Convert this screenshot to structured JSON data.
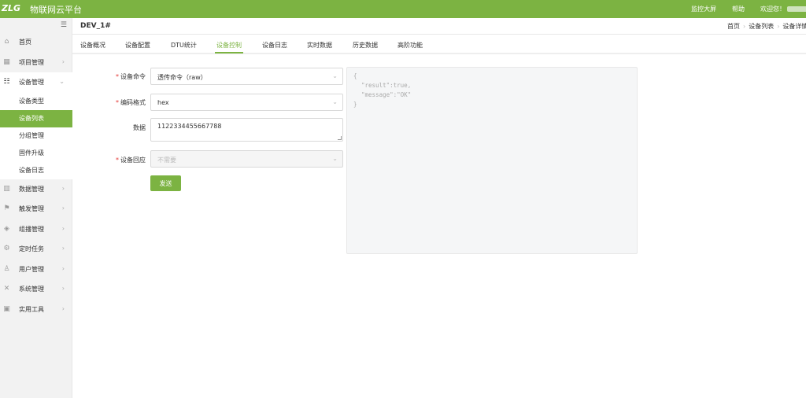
{
  "header": {
    "logo": "ZLG",
    "brand": "物联网云平台",
    "links": {
      "monitor": "监控大屏",
      "help": "帮助",
      "welcome": "欢迎您！"
    }
  },
  "sidebar": {
    "collapse_icon": "collapse-icon",
    "items": [
      {
        "label": "首页",
        "icon": "home-icon"
      },
      {
        "label": "项目管理",
        "icon": "project-icon"
      },
      {
        "label": "设备管理",
        "icon": "device-icon"
      },
      {
        "label": "数据管理",
        "icon": "chart-icon"
      },
      {
        "label": "触发管理",
        "icon": "flag-icon"
      },
      {
        "label": "组播管理",
        "icon": "layers-icon"
      },
      {
        "label": "定时任务",
        "icon": "gear-icon"
      },
      {
        "label": "用户管理",
        "icon": "user-icon"
      },
      {
        "label": "系统管理",
        "icon": "tools-icon"
      },
      {
        "label": "实用工具",
        "icon": "toolbox-icon"
      }
    ],
    "device_sub": [
      {
        "label": "设备类型"
      },
      {
        "label": "设备列表"
      },
      {
        "label": "分组管理"
      },
      {
        "label": "固件升级"
      },
      {
        "label": "设备日志"
      }
    ]
  },
  "page": {
    "title": "DEV_1#",
    "breadcrumb": [
      "首页",
      "设备列表",
      "设备详情"
    ]
  },
  "tabs": [
    {
      "label": "设备概况"
    },
    {
      "label": "设备配置"
    },
    {
      "label": "DTU统计"
    },
    {
      "label": "设备控制"
    },
    {
      "label": "设备日志"
    },
    {
      "label": "实时数据"
    },
    {
      "label": "历史数据"
    },
    {
      "label": "高阶功能"
    }
  ],
  "active_tab": "设备控制",
  "form": {
    "command": {
      "label": "设备命令",
      "value": "透传命令（raw）"
    },
    "encoding": {
      "label": "编码格式",
      "value": "hex"
    },
    "data": {
      "label": "数据",
      "value": "1122334455667788"
    },
    "response": {
      "label": "设备回应",
      "value": "不需要"
    },
    "send_label": "发送"
  },
  "response_panel": {
    "lines": [
      "{",
      "\"result\":true,",
      "\"message\":\"OK\"",
      "}"
    ]
  },
  "colors": {
    "brand": "#7cb342",
    "required": "#e53935"
  }
}
